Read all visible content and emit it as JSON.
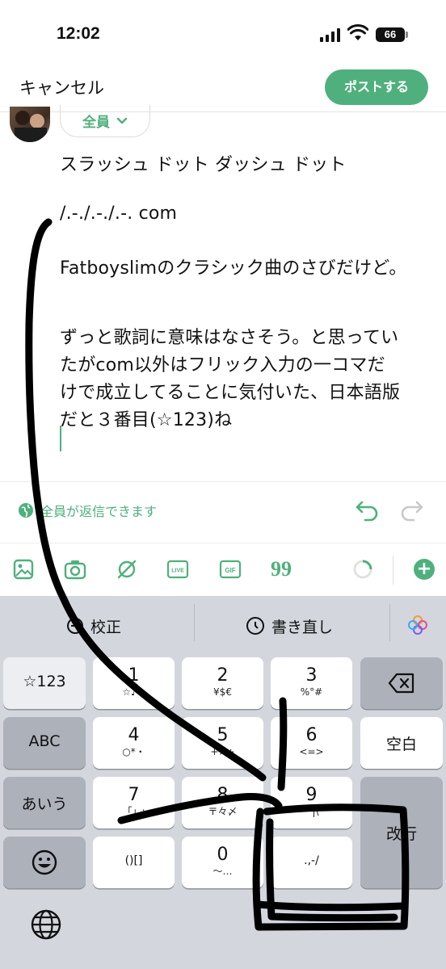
{
  "status_bar": {
    "time": "12:02",
    "battery": "66"
  },
  "header": {
    "cancel_label": "キャンセル",
    "post_label": "ポストする"
  },
  "composer": {
    "audience_label": "全員",
    "lines": [
      "スラッシュ ドット ダッシュ ドット",
      "/.-./.-./.-. com",
      "Fatboyslimのクラシック曲のさびだけど。",
      "ずっと歌詞に意味はなさそう。と思ってい",
      "たがcom以外はフリック入力の一コマだ",
      "けで成立してることに気付いた、日本語版",
      "だと３番目(☆123)ね"
    ],
    "reply_setting": "全員が返信できます"
  },
  "toolbar": {
    "icons": [
      "image-icon",
      "camera-icon",
      "grok-icon",
      "live-icon",
      "gif-icon",
      "quote-icon",
      "char-count-ring-icon"
    ],
    "live_label": "LIVE",
    "gif_label": "GIF",
    "quote_glyph": "99"
  },
  "keyboard": {
    "suggestions": {
      "proofread": "校正",
      "rewrite": "書き直し"
    },
    "left_keys": {
      "mode_123": "☆123",
      "abc": "ABC",
      "kana": "あいう"
    },
    "keys": [
      {
        "main": "1",
        "sub": "☆♪→"
      },
      {
        "main": "2",
        "sub": "¥$€"
      },
      {
        "main": "3",
        "sub": "%°#"
      },
      {
        "main": "4",
        "sub": "○*・"
      },
      {
        "main": "5",
        "sub": "+×÷"
      },
      {
        "main": "6",
        "sub": "<=>"
      },
      {
        "main": "7",
        "sub": "「」:"
      },
      {
        "main": "8",
        "sub": "〒々〆"
      },
      {
        "main": "9",
        "sub": "^|\\"
      },
      {
        "main": "",
        "sub": "()[]"
      },
      {
        "main": "0",
        "sub": "〜…"
      },
      {
        "main": "",
        "sub": ".,-/"
      }
    ],
    "space_label": "空白",
    "enter_label": "改行"
  }
}
